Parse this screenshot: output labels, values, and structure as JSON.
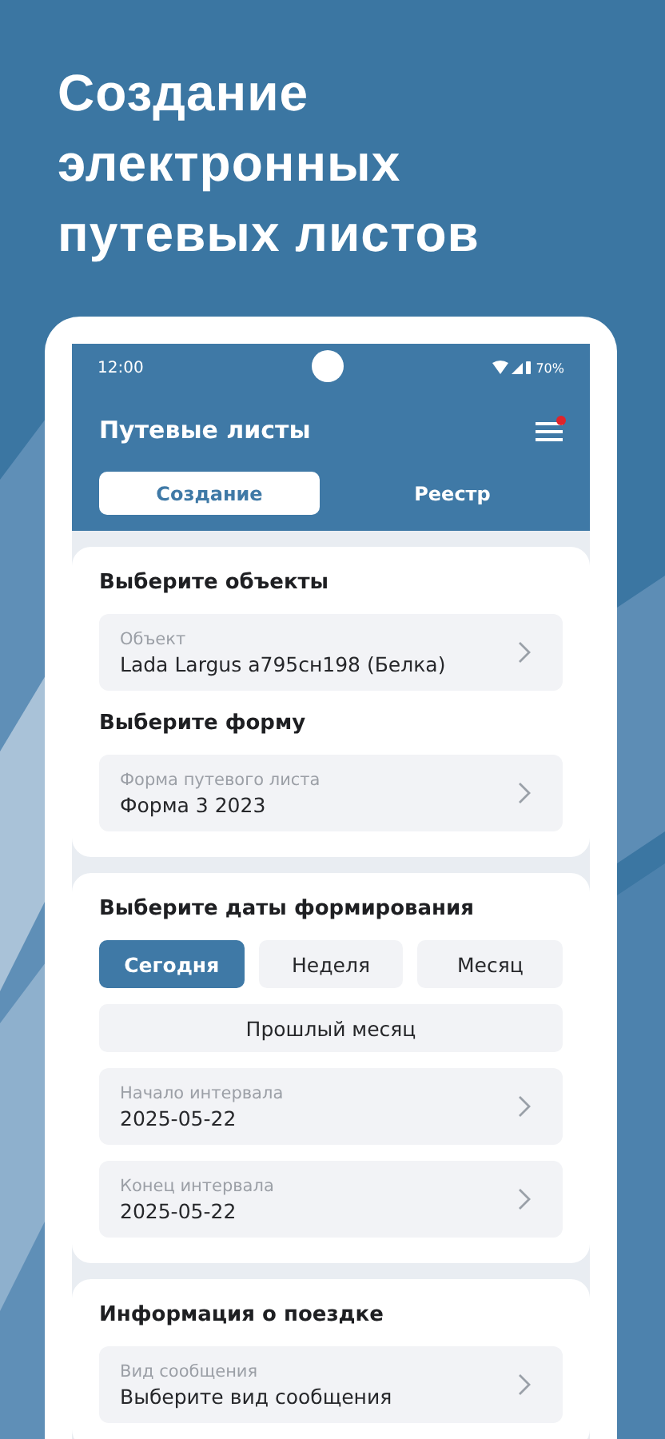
{
  "headline": [
    "Создание",
    "электронных",
    "путевых листов"
  ],
  "status_bar": {
    "time": "12:00",
    "battery": "70%"
  },
  "header": {
    "title": "Путевые листы",
    "notification": true
  },
  "tabs": [
    {
      "label": "Создание",
      "selected": true
    },
    {
      "label": "Реестр",
      "selected": false
    }
  ],
  "sections": [
    {
      "items": [
        {
          "kind": "heading",
          "text": "Выберите объекты"
        },
        {
          "kind": "select",
          "label": "Объект",
          "value": "Lada Largus а795сн198 (Белка)"
        },
        {
          "kind": "heading",
          "text": "Выберите форму"
        },
        {
          "kind": "select",
          "label": "Форма путевого листа",
          "value": "Форма 3 2023"
        }
      ]
    },
    {
      "items": [
        {
          "kind": "heading",
          "text": "Выберите даты формирования"
        },
        {
          "kind": "chips",
          "options": [
            {
              "label": "Сегодня",
              "selected": true
            },
            {
              "label": "Неделя",
              "selected": false
            },
            {
              "label": "Месяц",
              "selected": false
            }
          ]
        },
        {
          "kind": "chips",
          "options": [
            {
              "label": "Прошлый месяц",
              "selected": false
            }
          ]
        },
        {
          "kind": "select",
          "label": "Начало интервала",
          "value": "2025-05-22"
        },
        {
          "kind": "select",
          "label": "Конец интервала",
          "value": "2025-05-22"
        }
      ]
    },
    {
      "items": [
        {
          "kind": "heading",
          "text": "Информация о поездке"
        },
        {
          "kind": "select",
          "label": "Вид сообщения",
          "value": "Выберите вид сообщения"
        }
      ]
    }
  ]
}
